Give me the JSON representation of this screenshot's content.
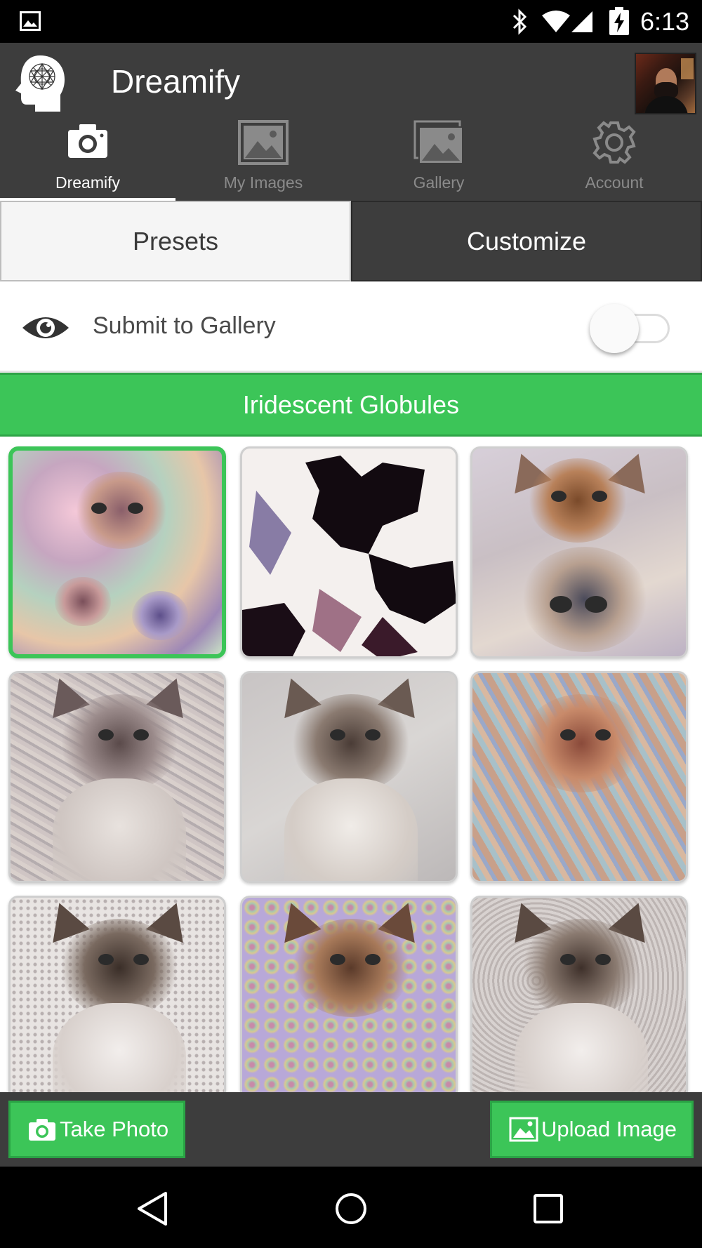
{
  "status_bar": {
    "time": "6:13",
    "icons": [
      "gallery-notification-icon",
      "bluetooth-icon",
      "wifi-icon",
      "cell-signal-icon",
      "battery-charging-icon"
    ]
  },
  "app_bar": {
    "title": "Dreamify",
    "logo_icon": "dreamify-head-logo",
    "avatar": "user-avatar-photo"
  },
  "tabs": [
    {
      "label": "Dreamify",
      "icon": "camera-icon",
      "active": true
    },
    {
      "label": "My Images",
      "icon": "image-icon",
      "active": false
    },
    {
      "label": "Gallery",
      "icon": "gallery-stack-icon",
      "active": false
    },
    {
      "label": "Account",
      "icon": "gear-icon",
      "active": false
    }
  ],
  "segments": {
    "presets": "Presets",
    "customize": "Customize"
  },
  "submit_row": {
    "label": "Submit to Gallery",
    "icon": "eye-icon",
    "toggle_on": false
  },
  "preset_banner": {
    "name": "Iridescent Globules"
  },
  "thumbnails": [
    {
      "style": "iridescent-globules",
      "selected": true
    },
    {
      "style": "ink-splatter",
      "selected": false
    },
    {
      "style": "dog-morph",
      "selected": false
    },
    {
      "style": "textured-cat",
      "selected": false
    },
    {
      "style": "original-cat",
      "selected": false
    },
    {
      "style": "patterned-cat",
      "selected": false
    },
    {
      "style": "pixel-dot-cat",
      "selected": false
    },
    {
      "style": "floral-cat",
      "selected": false
    },
    {
      "style": "maze-cat",
      "selected": false
    }
  ],
  "actions": {
    "take_photo": "Take Photo",
    "upload_image": "Upload Image"
  },
  "colors": {
    "accent_green": "#3cc558",
    "bar_gray": "#3d3d3d"
  }
}
